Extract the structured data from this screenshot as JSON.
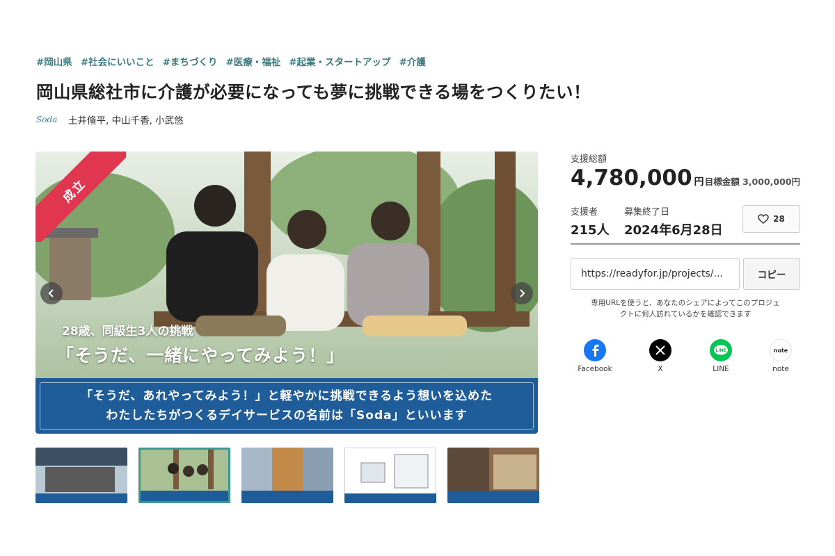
{
  "tags": [
    "#岡山県",
    "#社会にいいこと",
    "#まちづくり",
    "#医療・福祉",
    "#起業・スタートアップ",
    "#介護"
  ],
  "title": "岡山県総社市に介護が必要になっても夢に挑戦できる場をつくりたい！",
  "owner": {
    "logo": "Soda",
    "names": "土井脩平, 中山千香, 小武悠"
  },
  "main_image": {
    "ribbon": "成立",
    "subhead": "28歳、同級生3人の挑戦",
    "headline": "「そうだ、一緒にやってみよう！」",
    "band_line1": "「そうだ、あれやってみよう！」と軽やかに挑戦できるよう想いを込めた",
    "band_line2": "わたしたちがつくるデイサービスの名前は「Soda」といいます",
    "prev_icon": "chevron-left-icon",
    "next_icon": "chevron-right-icon"
  },
  "thumbnails": [
    "thumb-1",
    "thumb-2",
    "thumb-3",
    "thumb-4",
    "thumb-5"
  ],
  "stats": {
    "amount_label": "支援総額",
    "amount": "4,780,000",
    "amount_unit": "円",
    "goal_label": "目標金額",
    "goal_value": "3,000,000円",
    "supporters_label": "支援者",
    "supporters": "215人",
    "end_label": "募集終了日",
    "end_date": "2024年6月28日",
    "favorites": "28"
  },
  "share": {
    "url": "https://readyfor.jp/projects/...",
    "copy_label": "コピー",
    "note_line1": "専用URLを使うと、あなたのシェアによってこのプロジェ",
    "note_line2": "クトに何人訪れているかを確認できます",
    "services": [
      {
        "label": "Facebook",
        "icon": "facebook-icon",
        "color": "#1877f2"
      },
      {
        "label": "X",
        "icon": "x-icon",
        "color": "#000000"
      },
      {
        "label": "LINE",
        "icon": "line-icon",
        "color": "#06c755"
      },
      {
        "label": "note",
        "icon": "note-icon",
        "color": "#ffffff"
      }
    ]
  }
}
